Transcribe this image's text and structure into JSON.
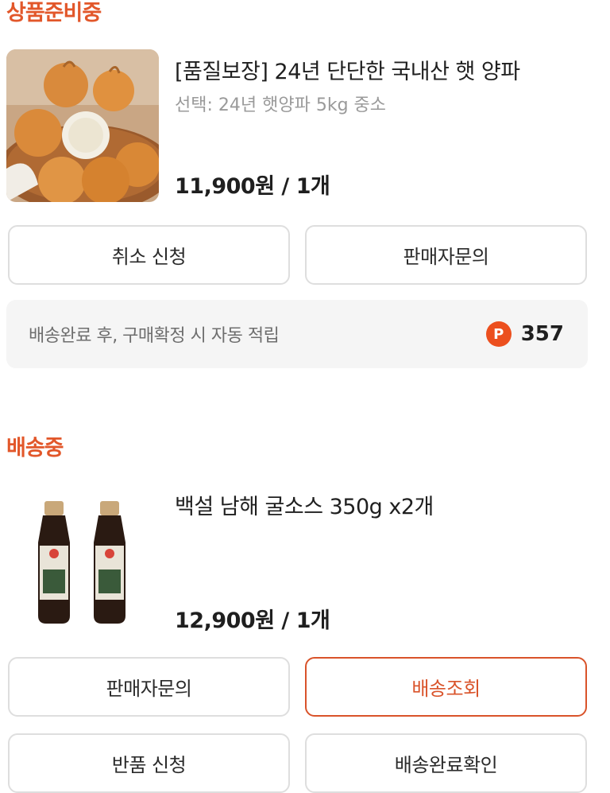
{
  "sections": [
    {
      "title": "상품준비중",
      "product": {
        "name": "[품질보장] 24년 단단한 국내산 햇 양파",
        "option": "선택: 24년 햇양파 5kg 중소",
        "price": "11,900원 / 1개",
        "image_icon": "onion-image"
      },
      "buttons": [
        "취소 신청",
        "판매자문의"
      ],
      "point_notice": {
        "text": "배송완료 후, 구매확정 시 자동 적립",
        "badge": "P",
        "value": "357"
      }
    },
    {
      "title": "배송중",
      "product": {
        "name": "백설 남해 굴소스 350g x2개",
        "price": "12,900원 / 1개",
        "image_icon": "oyster-sauce-bottles-image",
        "label_text": "굴소스",
        "brand_text": "백설"
      },
      "buttons": [
        "판매자문의",
        "배송조회",
        "반품 신청",
        "배송완료확인"
      ]
    }
  ],
  "colors": {
    "accent": "#e2572a",
    "button_border": "#dedede",
    "point_bg": "#f5f5f5",
    "point_badge": "#ec4f1e",
    "option_text": "#9a9a9a"
  }
}
